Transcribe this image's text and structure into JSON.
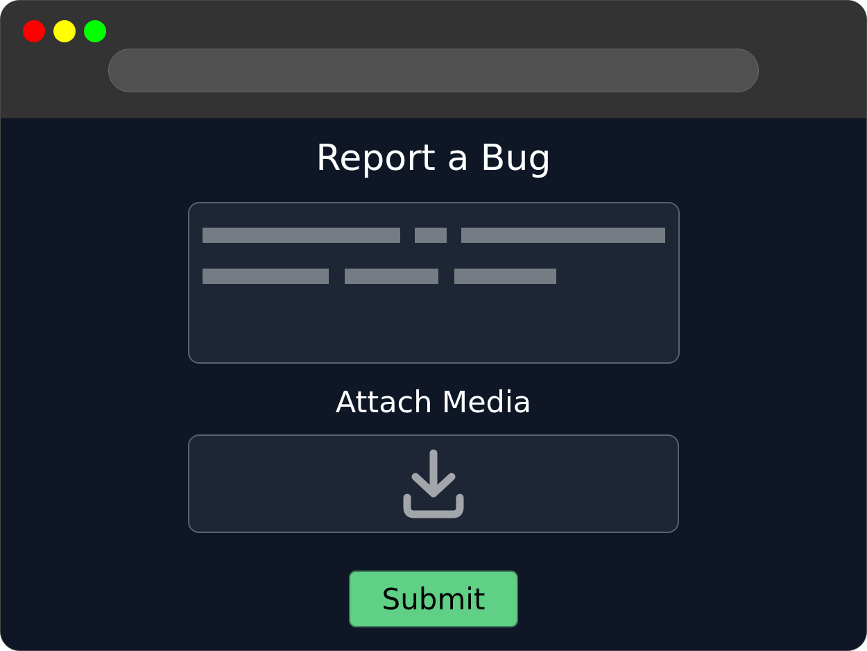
{
  "window": {
    "traffic_lights": [
      {
        "color": "#ff0000"
      },
      {
        "color": "#ffff00"
      },
      {
        "color": "#00ff00"
      }
    ]
  },
  "title": "Report a Bug",
  "attach_label": "Attach Media",
  "submit_button": "Submit"
}
